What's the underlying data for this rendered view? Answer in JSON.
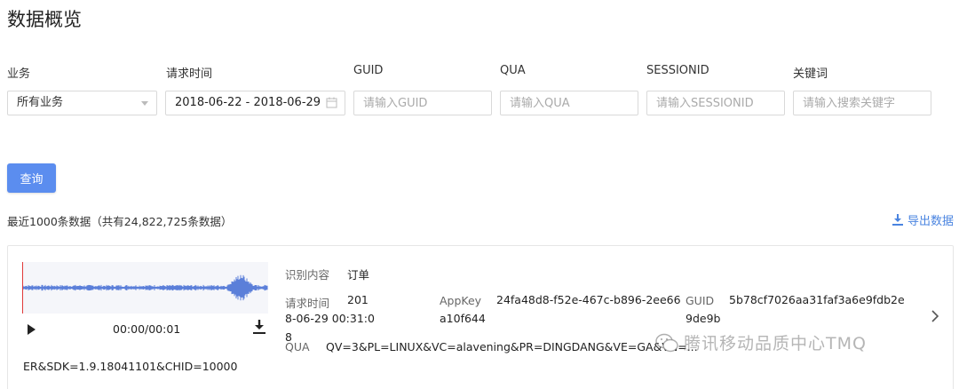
{
  "page": {
    "title": "数据概览"
  },
  "filters": {
    "business": {
      "label": "业务",
      "value": "所有业务"
    },
    "request_time": {
      "label": "请求时间",
      "value": "2018-06-22 - 2018-06-29"
    },
    "guid": {
      "label": "GUID",
      "placeholder": "请输入GUID"
    },
    "qua": {
      "label": "QUA",
      "placeholder": "请输入QUA"
    },
    "sessionid": {
      "label": "SESSIONID",
      "placeholder": "请输入SESSIONID"
    },
    "keyword": {
      "label": "关键词",
      "placeholder": "请输入搜索关键字"
    }
  },
  "actions": {
    "query_label": "查询",
    "export_label": "导出数据"
  },
  "summary": {
    "text": "最近1000条数据（共有24,822,725条数据）"
  },
  "record": {
    "audio": {
      "time": "00:00/00:01"
    },
    "recognized_label": "识别内容",
    "recognized_value": "订单",
    "request_time_label": "请求时间",
    "request_time_value": "2018-06-29 00:31:08",
    "appkey_label": "AppKey",
    "appkey_value": "24fa48d8-f52e-467c-b896-2ee66a10f644",
    "guid_label": "GUID",
    "guid_value": "5b78cf7026aa31faf3a6e9fdb2e9de9b",
    "qua_label": "QUA",
    "qua_value": "QV=3&PL=LINUX&VC=alavening&PR=DINGDANG&VE=GA&VN=...",
    "qua_tail": "ER&SDK=1.9.18041101&CHID=10000"
  },
  "watermark": {
    "text": "腾讯移动品质中心TMQ"
  },
  "colors": {
    "primary": "#5b8def",
    "link": "#4a84e0",
    "playhead": "#e03a3a",
    "waveform": "#5b7fd9"
  },
  "icons": {
    "play": "play-icon",
    "download": "download-icon",
    "calendar": "calendar-icon",
    "export": "export-icon",
    "chevron": "chevron-right-icon"
  }
}
